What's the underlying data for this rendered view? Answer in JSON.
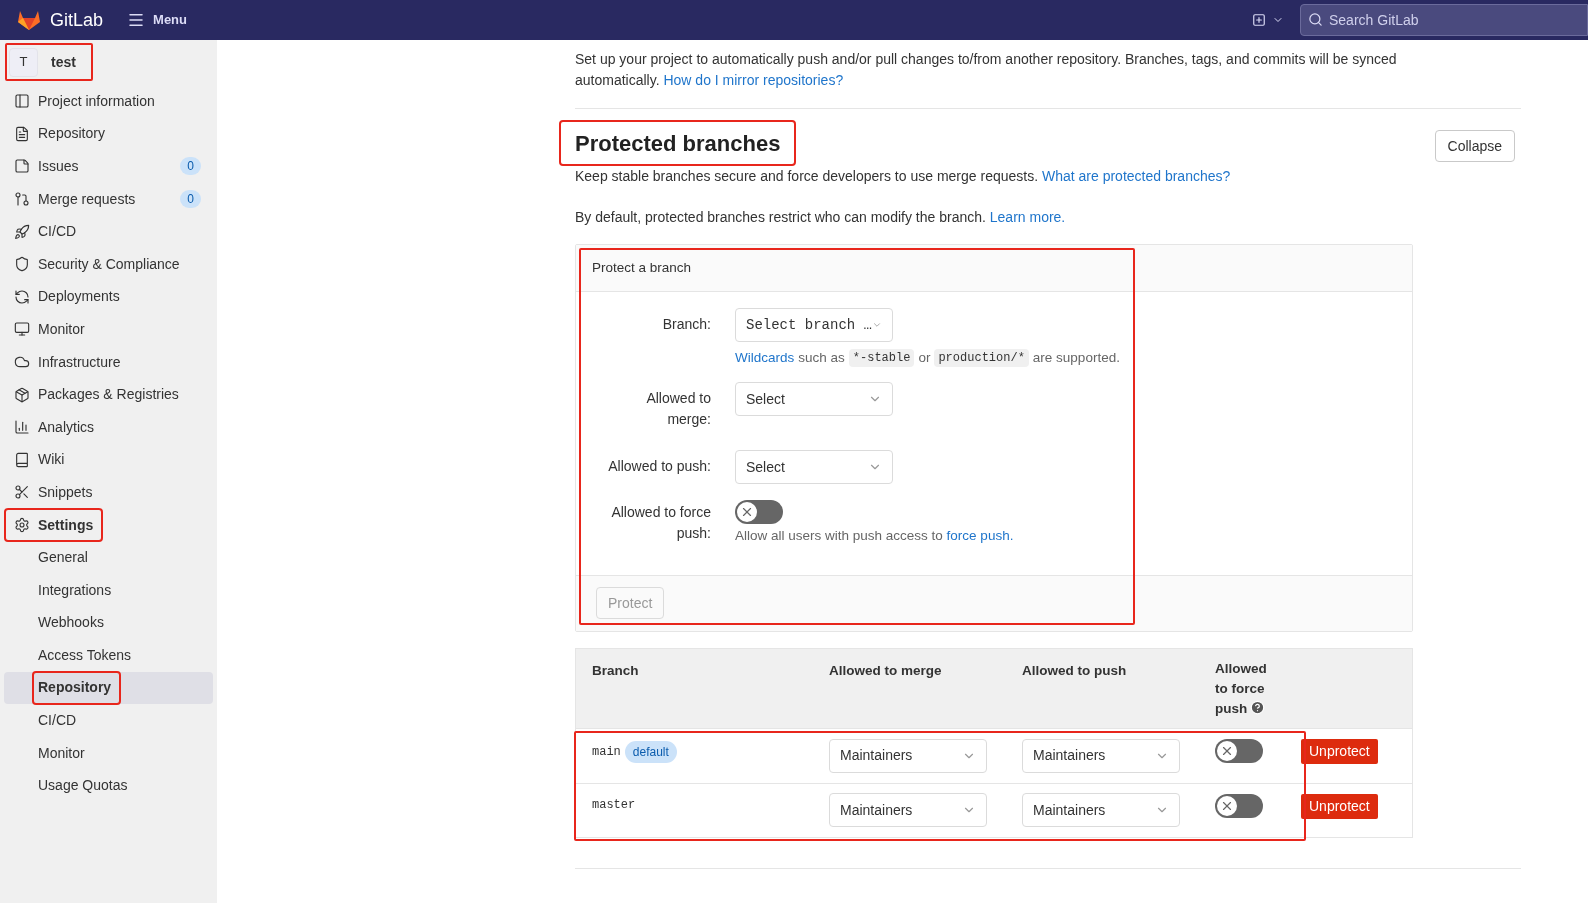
{
  "topbar": {
    "brand": "GitLab",
    "menu": "Menu",
    "search": {
      "placeholder": "Search GitLab"
    }
  },
  "sidebar": {
    "project": {
      "initial": "T",
      "name": "test",
      "highlighted": true
    },
    "items": [
      {
        "label": "Project information",
        "selected": false,
        "highlighted": false
      },
      {
        "label": "Repository",
        "selected": false,
        "highlighted": false
      },
      {
        "label": "Issues",
        "badge": "0",
        "selected": false,
        "highlighted": false
      },
      {
        "label": "Merge requests",
        "badge": "0",
        "selected": false,
        "highlighted": false
      },
      {
        "label": "CI/CD",
        "selected": false,
        "highlighted": false
      },
      {
        "label": "Security & Compliance",
        "selected": false,
        "highlighted": false
      },
      {
        "label": "Deployments",
        "selected": false,
        "highlighted": false
      },
      {
        "label": "Monitor",
        "selected": false,
        "highlighted": false
      },
      {
        "label": "Infrastructure",
        "selected": false,
        "highlighted": false
      },
      {
        "label": "Packages & Registries",
        "selected": false,
        "highlighted": false
      },
      {
        "label": "Analytics",
        "selected": false,
        "highlighted": false
      },
      {
        "label": "Wiki",
        "selected": false,
        "highlighted": false
      },
      {
        "label": "Snippets",
        "selected": false,
        "highlighted": false
      },
      {
        "label": "Settings",
        "selected": false,
        "highlighted": true,
        "children": [
          {
            "label": "General",
            "selected": false,
            "highlighted": false
          },
          {
            "label": "Integrations",
            "selected": false,
            "highlighted": false
          },
          {
            "label": "Webhooks",
            "selected": false,
            "highlighted": false
          },
          {
            "label": "Access Tokens",
            "selected": false,
            "highlighted": false
          },
          {
            "label": "Repository",
            "selected": true,
            "highlighted": true
          },
          {
            "label": "CI/CD",
            "selected": false,
            "highlighted": false
          },
          {
            "label": "Monitor",
            "selected": false,
            "highlighted": false
          },
          {
            "label": "Usage Quotas",
            "selected": false,
            "highlighted": false
          }
        ]
      }
    ]
  },
  "mirror": {
    "text": "Set up your project to automatically push and/or pull changes to/from another repository. Branches, tags, and commits will be synced automatically.",
    "link": "How do I mirror repositories?"
  },
  "section": {
    "title": "Protected branches",
    "highlighted": true,
    "collapse": "Collapse",
    "description": {
      "text": "Keep stable branches secure and force developers to use merge requests.",
      "link": "What are protected branches?"
    },
    "note": {
      "text": "By default, protected branches restrict who can modify the branch.",
      "link": "Learn more."
    }
  },
  "protect_form": {
    "title": "Protect a branch",
    "highlighted": true,
    "branch": {
      "label": "Branch:",
      "value": "Select branch …",
      "help_link": "Wildcards",
      "help_1": "such as",
      "code_1": "*-stable",
      "help_2": "or",
      "code_2": "production/*",
      "help_3": "are supported."
    },
    "merge": {
      "label": "Allowed to merge:",
      "value": "Select"
    },
    "push": {
      "label": "Allowed to push:",
      "value": "Select"
    },
    "force_push": {
      "label": "Allowed to force push:",
      "on": false,
      "help": "Allow all users with push access to",
      "help_link": "force push."
    },
    "submit": {
      "label": "Protect",
      "disabled": true
    }
  },
  "table": {
    "columns": [
      "Branch",
      "Allowed to merge",
      "Allowed to push",
      "Allowed to force push"
    ],
    "rows_highlighted": true,
    "rows": [
      {
        "branch": "main",
        "badge": "default",
        "merge": "Maintainers",
        "push": "Maintainers",
        "force_push": false,
        "action": "Unprotect"
      },
      {
        "branch": "master",
        "merge": "Maintainers",
        "push": "Maintainers",
        "force_push": false,
        "action": "Unprotect"
      }
    ]
  }
}
